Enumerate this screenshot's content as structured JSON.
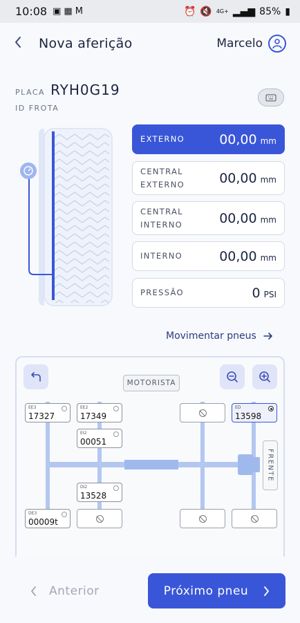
{
  "status_bar": {
    "time": "10:08",
    "battery": "85%",
    "network": "4G+"
  },
  "header": {
    "title": "Nova aferição",
    "user_name": "Marcelo"
  },
  "vehicle": {
    "plate_label": "PLACA",
    "plate": "RYH0G19",
    "fleet_label": "ID FROTA"
  },
  "measurements": [
    {
      "label_lines": [
        "EXTERNO"
      ],
      "value": "00,00",
      "unit": "mm",
      "active": true
    },
    {
      "label_lines": [
        "CENTRAL",
        "EXTERNO"
      ],
      "value": "00,00",
      "unit": "mm",
      "active": false
    },
    {
      "label_lines": [
        "CENTRAL",
        "INTERNO"
      ],
      "value": "00,00",
      "unit": "mm",
      "active": false
    },
    {
      "label_lines": [
        "INTERNO"
      ],
      "value": "00,00",
      "unit": "mm",
      "active": false
    },
    {
      "label_lines": [
        "PRESSÃO"
      ],
      "value": "0",
      "unit": "PSI",
      "active": false
    }
  ],
  "move_tires_label": "Movimentar pneus",
  "diagram": {
    "driver_label": "MOTORISTA",
    "front_label": "FRENTE",
    "slots": [
      {
        "code": "EE3",
        "number": "17327",
        "empty": false,
        "selected": false
      },
      {
        "code": "EE2",
        "number": "17349",
        "empty": false,
        "selected": false
      },
      {
        "code": "EI2",
        "number": "00051",
        "empty": false,
        "selected": false
      },
      {
        "code": "",
        "number": "",
        "empty": true,
        "selected": false
      },
      {
        "code": "ED",
        "number": "13598",
        "empty": false,
        "selected": true
      },
      {
        "code": "DI2",
        "number": "13528",
        "empty": false,
        "selected": false
      },
      {
        "code": "DE3",
        "number": "00009t",
        "empty": false,
        "selected": false
      },
      {
        "code": "",
        "number": "",
        "empty": true,
        "selected": false
      },
      {
        "code": "",
        "number": "",
        "empty": true,
        "selected": false
      },
      {
        "code": "",
        "number": "",
        "empty": true,
        "selected": false
      }
    ]
  },
  "footer": {
    "prev_label": "Anterior",
    "next_label": "Próximo pneu"
  }
}
